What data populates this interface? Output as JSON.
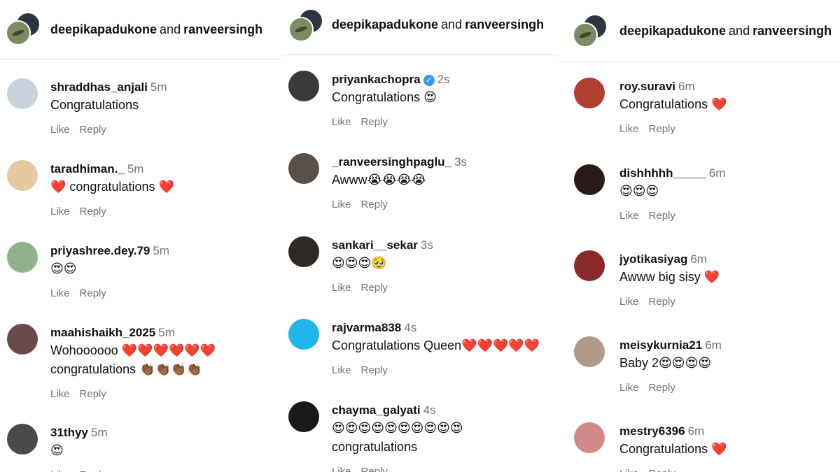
{
  "header": {
    "user1": "deepikapadukone",
    "and": "and",
    "user2": "ranveersingh"
  },
  "actions": {
    "like": "Like",
    "reply": "Reply"
  },
  "colors": {
    "muted": "#737373",
    "verified": "#3897f0",
    "divider": "#dbdbdb"
  },
  "panel1": {
    "header_text": "deepikapadukone and ranveersingh",
    "comments": [
      {
        "user": "shraddhas_anjali",
        "time": "5m",
        "text": "Congratulations",
        "avatar_color": "#c9d3e0"
      },
      {
        "user": "taradhiman._",
        "time": "5m",
        "text": "❤️ congratulations ❤️",
        "avatar_color": "#e7c9a0"
      },
      {
        "user": "priyashree.dey.79",
        "time": "5m",
        "text": "😍😍",
        "avatar_color": "#8fb28a"
      },
      {
        "user": "maahishaikh_2025",
        "time": "5m",
        "text": "Wohoooooo ❤️❤️❤️❤️❤️❤️",
        "text2": "congratulations 👏🏾👏🏾👏🏾👏🏾",
        "avatar_color": "#6b4a4a"
      },
      {
        "user": "31thyy",
        "time": "5m",
        "text": "😍",
        "avatar_color": "#4a4a4a"
      }
    ]
  },
  "panel2": {
    "comments": [
      {
        "user": "priyankachopra",
        "time": "2s",
        "text": "Congratulations 😍",
        "verified": "✓",
        "avatar_color": "#3a3a3a"
      },
      {
        "user": "_ranveersinghpaglu_",
        "time": "3s",
        "text": "Awww😭😭😭😭",
        "avatar_color": "#5a5048"
      },
      {
        "user": "sankari__sekar",
        "time": "3s",
        "text": "😍😍😍🥹",
        "avatar_color": "#2e2a28"
      },
      {
        "user": "rajvarma838",
        "time": "4s",
        "text": "Congratulations Queen❤️❤️❤️❤️❤️",
        "avatar_color": "#1fb6ea"
      },
      {
        "user": "chayma_galyati",
        "time": "4s",
        "text": "😍😍😍😍😍😍😍😍😍😍",
        "text2": "congratulations",
        "avatar_color": "#1a1a1a"
      }
    ]
  },
  "panel3": {
    "comments": [
      {
        "user": "roy.suravi",
        "time": "6m",
        "text": "Congratulations ❤️",
        "avatar_color": "#b04030"
      },
      {
        "user": "dishhhhh_____",
        "time": "6m",
        "text": "😍😍😍",
        "avatar_color": "#2a1a1a"
      },
      {
        "user": "jyotikasiyag",
        "time": "6m",
        "text": "Awww big sisy ❤️",
        "avatar_color": "#8a2a2a"
      },
      {
        "user": "meisykurnia21",
        "time": "6m",
        "text": "Baby 2😍😍😍😍",
        "avatar_color": "#b09a88"
      },
      {
        "user": "mestry6396",
        "time": "6m",
        "text": "Congratulations ❤️",
        "avatar_color": "#d08a8a"
      }
    ]
  }
}
